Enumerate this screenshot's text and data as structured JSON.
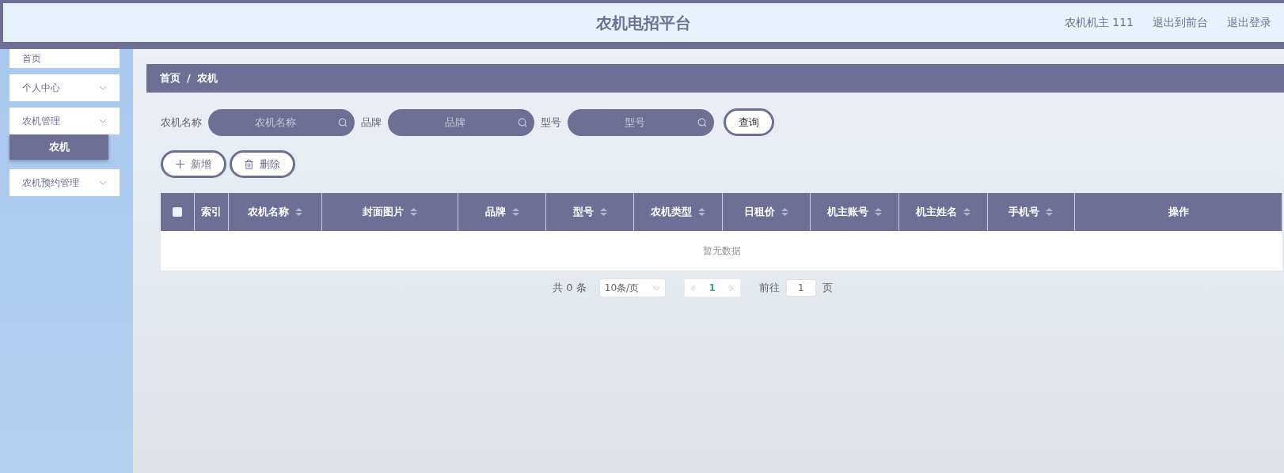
{
  "header": {
    "title": "农机电招平台",
    "links": [
      "农机机主 111",
      "退出到前台",
      "退出登录"
    ]
  },
  "sidebar": {
    "items": [
      {
        "label": "首页",
        "selected": false,
        "kind": "link"
      },
      {
        "label": "个人中心",
        "selected": false,
        "kind": "submenu"
      },
      {
        "label": "农机管理",
        "selected": false,
        "kind": "submenu",
        "children": [
          {
            "label": "农机",
            "selected": true
          }
        ]
      },
      {
        "label": "农机预约管理",
        "selected": false,
        "kind": "submenu"
      }
    ]
  },
  "breadcrumb": [
    "首页",
    "农机"
  ],
  "breadcrumb_separator": "/",
  "search": {
    "fields": [
      {
        "label": "农机名称",
        "placeholder": "农机名称"
      },
      {
        "label": "品牌",
        "placeholder": "品牌"
      },
      {
        "label": "型号",
        "placeholder": "型号"
      }
    ],
    "button": "查询"
  },
  "actions": [
    {
      "kind": "add",
      "label": "新增"
    },
    {
      "kind": "delete",
      "label": "删除"
    }
  ],
  "table": {
    "select_all_checked": false,
    "columns": [
      {
        "label": "索引",
        "sortable": false
      },
      {
        "label": "农机名称",
        "sortable": true
      },
      {
        "label": "封面图片",
        "sortable": true
      },
      {
        "label": "品牌",
        "sortable": true
      },
      {
        "label": "型号",
        "sortable": true
      },
      {
        "label": "农机类型",
        "sortable": true
      },
      {
        "label": "日租价",
        "sortable": true
      },
      {
        "label": "机主账号",
        "sortable": true
      },
      {
        "label": "机主姓名",
        "sortable": true
      },
      {
        "label": "手机号",
        "sortable": true
      },
      {
        "label": "操作",
        "sortable": false
      }
    ],
    "empty_text": "暂无数据"
  },
  "pagination": {
    "total": "共 0 条",
    "page_size": "10条/页",
    "pages": [
      {
        "label": "1",
        "selected": true
      }
    ],
    "goto_label": "前往",
    "goto_value": "1",
    "page_suffix": "页"
  }
}
